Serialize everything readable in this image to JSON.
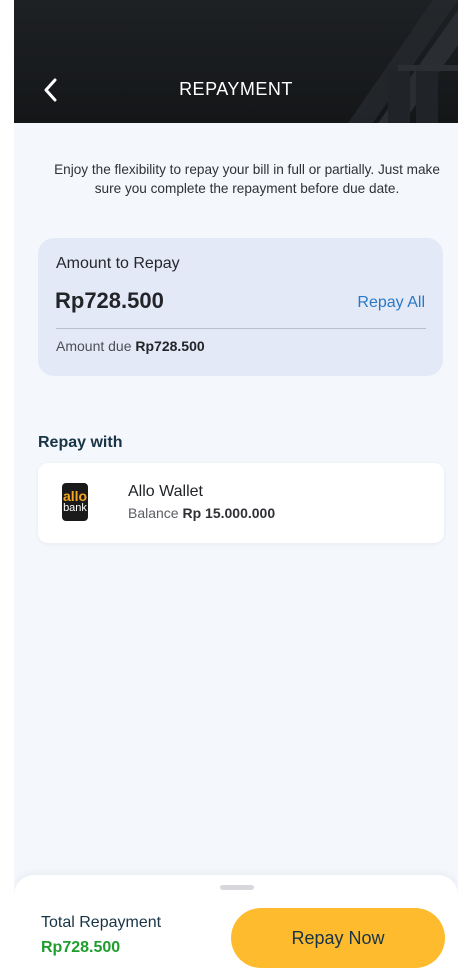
{
  "header": {
    "title": "REPAYMENT",
    "back_icon": "chevron-left-icon"
  },
  "intro_text": "Enjoy the flexibility to repay your bill in full or partially. Just make sure you complete the repayment before due date.",
  "amount_card": {
    "label": "Amount to Repay",
    "value": "Rp728.500",
    "repay_all_label": "Repay All",
    "due_prefix": "Amount due",
    "due_value": "Rp728.500"
  },
  "repay_with": {
    "title": "Repay with",
    "method": {
      "logo_line1": "allo",
      "logo_line2": "bank",
      "name": "Allo Wallet",
      "balance_prefix": "Balance",
      "balance_value": "Rp 15.000.000"
    }
  },
  "footer": {
    "total_label": "Total Repayment",
    "total_value": "Rp728.500",
    "button_label": "Repay Now"
  },
  "colors": {
    "header_bg": "#1a1c1f",
    "card_bg": "#e4e9f7",
    "link": "#2b79c4",
    "total_value": "#1f9e2e",
    "button": "#fdbb2d"
  }
}
